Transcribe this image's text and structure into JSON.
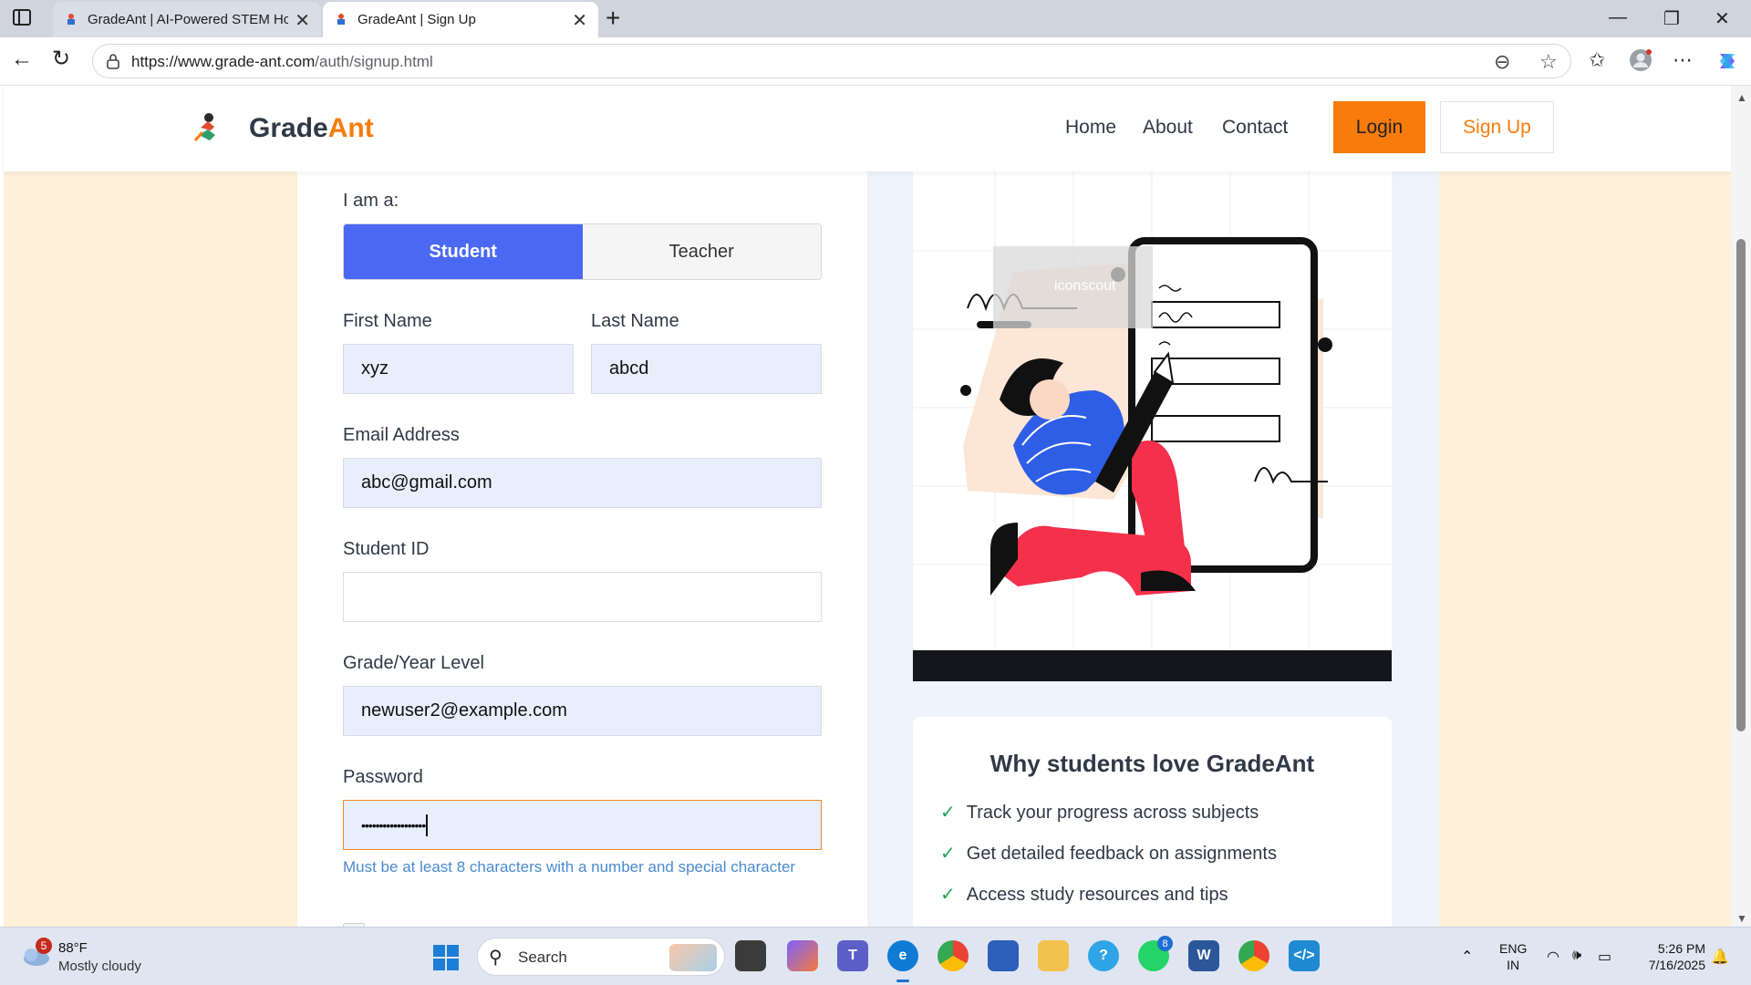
{
  "browser": {
    "tabs": [
      {
        "title": "GradeAnt | AI-Powered STEM Hor",
        "active": false
      },
      {
        "title": "GradeAnt | Sign Up",
        "active": true
      }
    ],
    "url_host": "https://www.grade-ant.com",
    "url_path": "/auth/signup.html"
  },
  "site": {
    "brand_main": "Grade",
    "brand_accent": "Ant",
    "nav": [
      "Home",
      "About",
      "Contact"
    ],
    "login_label": "Login",
    "signup_label": "Sign Up",
    "accent_color": "#f97b0b"
  },
  "form": {
    "role_label": "I am a:",
    "role_options": [
      "Student",
      "Teacher"
    ],
    "role_selected": "Student",
    "first_name_label": "First Name",
    "first_name_value": "xyz",
    "last_name_label": "Last Name",
    "last_name_value": "abcd",
    "email_label": "Email Address",
    "email_value": "abc@gmail.com",
    "student_id_label": "Student ID",
    "student_id_value": "",
    "grade_label": "Grade/Year Level",
    "grade_value": "newuser2@example.com",
    "password_label": "Password",
    "password_value": "••••••••••••••••••",
    "password_hint": "Must be at least 8 characters with a number and special character"
  },
  "panel": {
    "illustration_watermark": "iconscout",
    "why_title": "Why students love GradeAnt",
    "why_items": [
      "Track your progress across subjects",
      "Get detailed feedback on assignments",
      "Access study resources and tips"
    ]
  },
  "taskbar": {
    "weather_alerts": "5",
    "weather_temp": "88°F",
    "weather_desc": "Mostly cloudy",
    "search_placeholder": "Search",
    "teams_badge": "8",
    "lang_line1": "ENG",
    "lang_line2": "IN",
    "time": "5:26 PM",
    "date": "7/16/2025"
  }
}
